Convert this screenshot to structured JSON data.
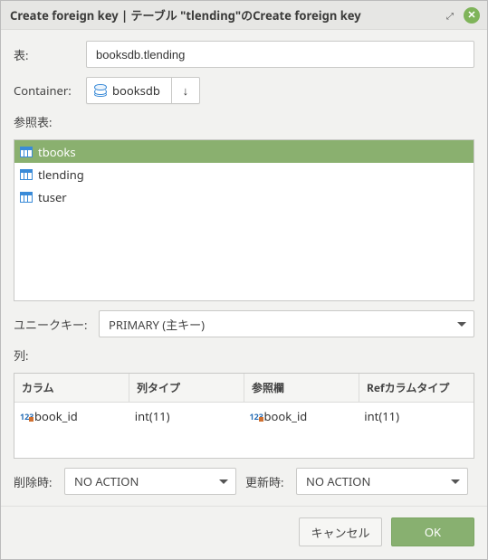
{
  "titlebar": {
    "text": "Create foreign key | テーブル \"tlending\"のCreate foreign key"
  },
  "labels": {
    "table": "表:",
    "container": "Container:",
    "refTable": "参照表:",
    "uniqueKey": "ユニークキー:",
    "columns": "列:",
    "onDelete": "削除時:",
    "onUpdate": "更新時:"
  },
  "tableInput": {
    "value": "booksdb.tlending"
  },
  "container": {
    "name": "booksdb"
  },
  "refTables": [
    {
      "name": "tbooks",
      "selected": true
    },
    {
      "name": "tlending",
      "selected": false
    },
    {
      "name": "tuser",
      "selected": false
    }
  ],
  "uniqueKey": {
    "value": "PRIMARY (主キー)"
  },
  "columnsTable": {
    "headers": {
      "col": "カラム",
      "colType": "列タイプ",
      "refCol": "参照欄",
      "refColType": "Refカラムタイプ"
    },
    "rows": [
      {
        "col": "book_id",
        "colType": "int(11)",
        "refCol": "book_id",
        "refColType": "int(11)"
      }
    ]
  },
  "onDelete": {
    "value": "NO ACTION"
  },
  "onUpdate": {
    "value": "NO ACTION"
  },
  "buttons": {
    "cancel": "キャンセル",
    "ok": "OK"
  }
}
